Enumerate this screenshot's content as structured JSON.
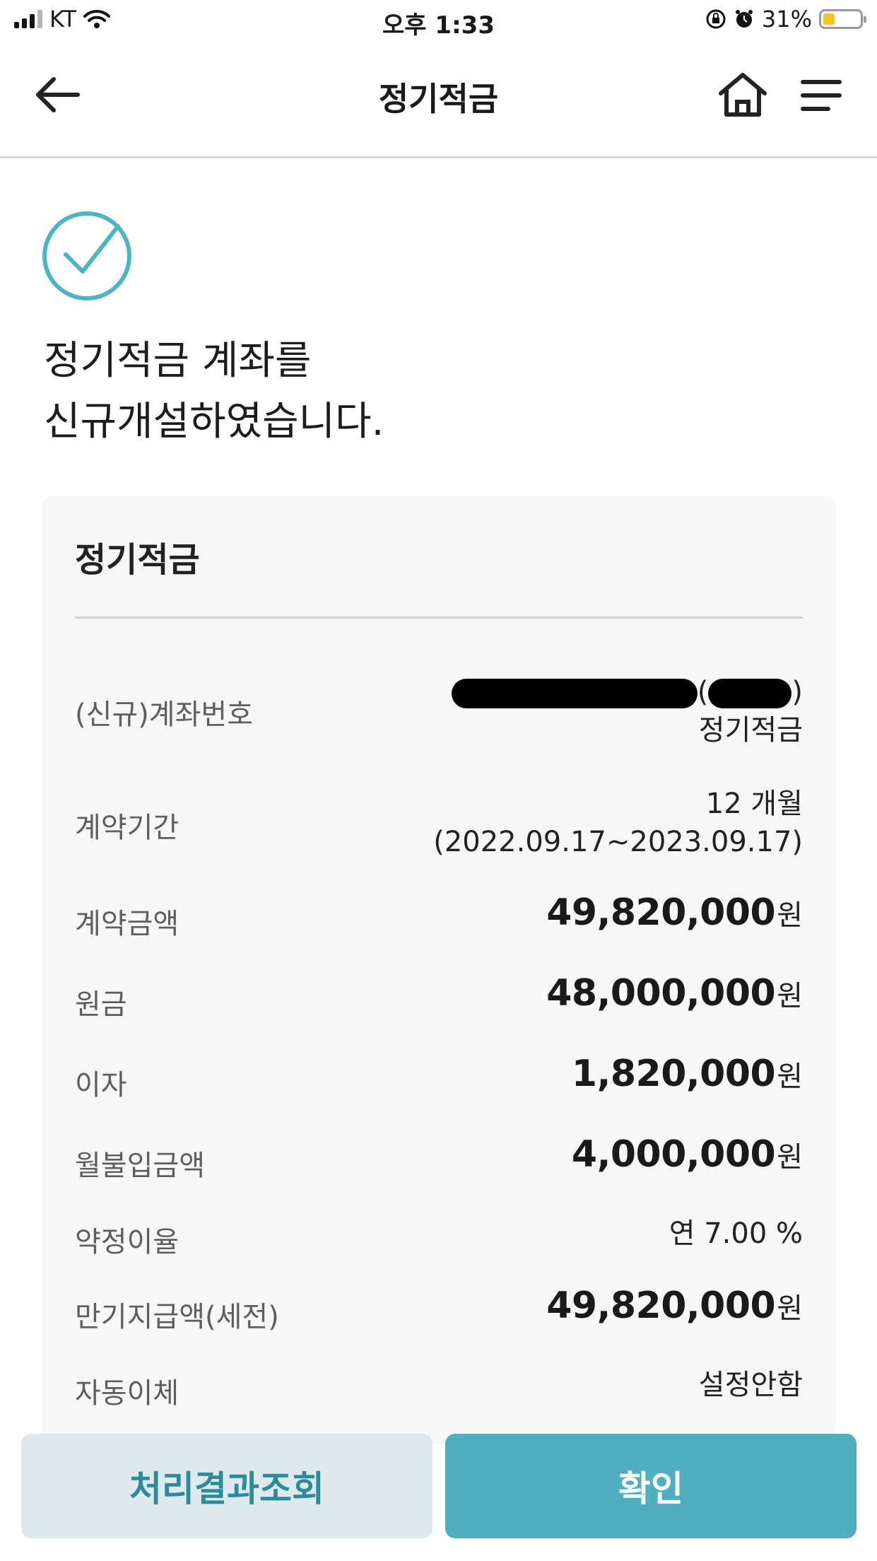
{
  "status_bar": {
    "carrier": "KT",
    "time": "오후 1:33",
    "battery": "31%",
    "icons": [
      "signal-icon",
      "wifi-icon",
      "orientation-lock-icon",
      "alarm-icon",
      "battery-icon"
    ]
  },
  "header": {
    "title": "정기적금",
    "icons": [
      "back-arrow-icon",
      "home-icon",
      "menu-icon"
    ]
  },
  "result": {
    "icon": "check-circle-icon",
    "line1": "정기적금 계좌를",
    "line2": "신규개설하였습니다."
  },
  "card": {
    "title": "정기적금",
    "rows": [
      {
        "label": "(신규)계좌번호",
        "value_paren_open": "(",
        "value_paren_close": ")",
        "sub": "정기적금"
      },
      {
        "label": "계약기간",
        "line1": "12 개월",
        "line2": "(2022.09.17~2023.09.17)"
      },
      {
        "label": "계약금액",
        "amount": "49,820,000",
        "unit": "원"
      },
      {
        "label": "원금",
        "amount": "48,000,000",
        "unit": "원"
      },
      {
        "label": "이자",
        "amount": "1,820,000",
        "unit": "원"
      },
      {
        "label": "월불입금액",
        "amount": "4,000,000",
        "unit": "원"
      },
      {
        "label": "약정이율",
        "value": "연 7.00 %"
      },
      {
        "label": "만기지급액(세전)",
        "amount": "49,820,000",
        "unit": "원"
      },
      {
        "label": "자동이체",
        "value": "설정안함"
      }
    ]
  },
  "buttons": {
    "query": "처리결과조회",
    "confirm": "확인"
  },
  "colors": {
    "accent": "#4faebf",
    "accent_light": "#dde9ec",
    "accent_text": "#2d8a99",
    "check": "#4ab5c4"
  }
}
